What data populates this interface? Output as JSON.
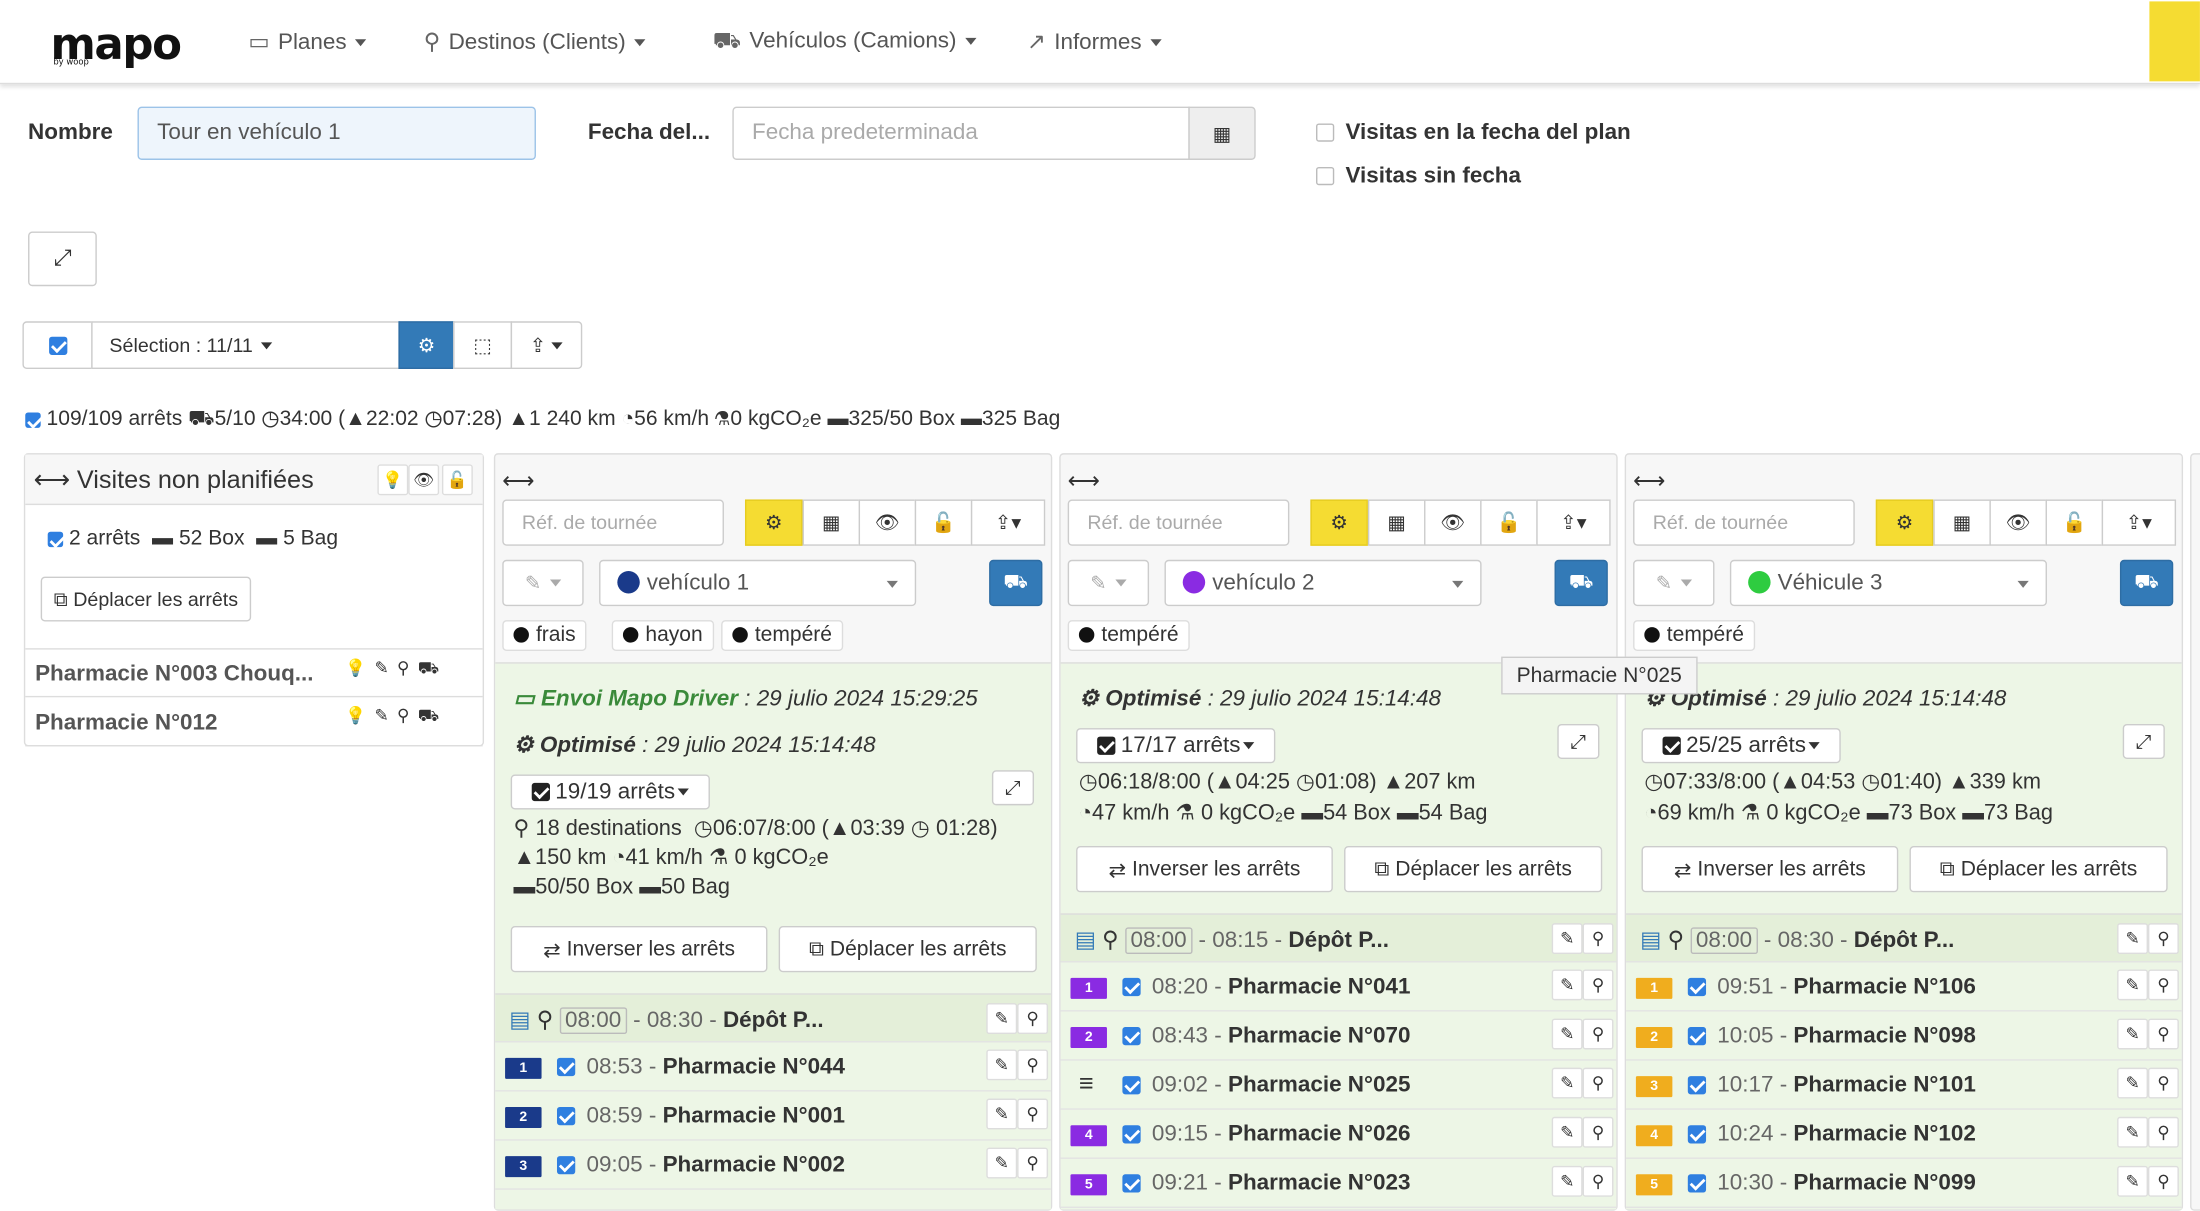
{
  "nav": {
    "logo": "mapo",
    "logo_sub": "by woop",
    "items": [
      "Planes",
      "Destinos (Clients)",
      "Vehículos (Camions)",
      "Informes"
    ]
  },
  "form": {
    "name_label": "Nombre",
    "name_value": "Tour en vehículo 1",
    "date_label": "Fecha del...",
    "date_placeholder": "Fecha predeterminada",
    "chk1": "Visitas en la fecha del plan",
    "chk2": "Visitas sin fecha"
  },
  "selection": {
    "label": "Sélection : 11/11"
  },
  "summary": {
    "stops": "109/109 arrêts",
    "vehicles": "5/10",
    "time": "34:00",
    "drive": "22:02",
    "wait": "07:28)",
    "km": "1 240 km",
    "speed": "56 km/h",
    "co2": "0 kgCO₂e",
    "box": "325/50 Box",
    "bag": "325 Bag"
  },
  "unplanned": {
    "title": "Visites non planifiées",
    "stops": "2 arrêts",
    "box": "52 Box",
    "bag": "5 Bag",
    "move": "Déplacer les arrêts",
    "items": [
      "Pharmacie N°003 Chouq...",
      "Pharmacie N°012"
    ]
  },
  "common": {
    "ref_placeholder": "Réf. de tournée",
    "invert": "Inverser les arrêts",
    "move": "Déplacer les arrêts",
    "optimised": "Optimisé",
    "opt_date": ": 29 julio 2024 15:14:48",
    "tooltip": "Pharmacie N°025"
  },
  "v1": {
    "name": "vehículo 1",
    "color": "#1a3a8a",
    "tags": [
      "frais",
      "hayon",
      "tempéré"
    ],
    "sent": "Envoi Mapo Driver",
    "sent_date": ": 29 julio 2024 15:29:25",
    "stops_btn": "19/19 arrêts",
    "line1": "18 destinations",
    "line1b": "06:07/8:00 (",
    "line1c": "03:39",
    "line2": "01:28)",
    "line2b": "150 km",
    "line2c": "41 km/h",
    "line2d": "0 kgCO₂e",
    "line3": "50/50 Box",
    "line3b": "50 Bag",
    "depot_start": "08:00",
    "depot_end": "- 08:30 -",
    "depot": "Dépôt P...",
    "stops": [
      {
        "n": "1",
        "time": "08:53",
        "name": "Pharmacie N°044"
      },
      {
        "n": "2",
        "time": "08:59",
        "name": "Pharmacie N°001"
      },
      {
        "n": "3",
        "time": "09:05",
        "name": "Pharmacie N°002"
      }
    ]
  },
  "v2": {
    "name": "vehículo 2",
    "color": "#8a2be2",
    "tags": [
      "tempéré"
    ],
    "stops_btn": "17/17 arrêts",
    "l1": "06:18/8:00 (",
    "l1b": "04:25",
    "l1c": "01:08)",
    "l1d": "207 km",
    "l2": "47 km/h",
    "l2b": "0 kgCO₂e",
    "l2c": "54 Box",
    "l2d": "54 Bag",
    "depot_start": "08:00",
    "depot_end": "- 08:15 -",
    "depot": "Dépôt P...",
    "stops": [
      {
        "n": "1",
        "time": "08:20",
        "name": "Pharmacie N°041"
      },
      {
        "n": "2",
        "time": "08:43",
        "name": "Pharmacie N°070"
      },
      {
        "n": "",
        "time": "09:02",
        "name": "Pharmacie N°025"
      },
      {
        "n": "4",
        "time": "09:15",
        "name": "Pharmacie N°026"
      },
      {
        "n": "5",
        "time": "09:21",
        "name": "Pharmacie N°023"
      }
    ]
  },
  "v3": {
    "name": "Véhicule 3",
    "color": "#2ecc40",
    "tags": [
      "tempéré"
    ],
    "stops_btn": "25/25 arrêts",
    "l1": "07:33/8:00 (",
    "l1b": "04:53",
    "l1c": "01:40)",
    "l1d": "339 km",
    "l2": "69 km/h",
    "l2b": "0 kgCO₂e",
    "l2c": "73 Box",
    "l2d": "73 Bag",
    "depot_start": "08:00",
    "depot_end": "- 08:30 -",
    "depot": "Dépôt P...",
    "stops": [
      {
        "n": "1",
        "time": "09:51",
        "name": "Pharmacie N°106"
      },
      {
        "n": "2",
        "time": "10:05",
        "name": "Pharmacie N°098"
      },
      {
        "n": "3",
        "time": "10:17",
        "name": "Pharmacie N°101"
      },
      {
        "n": "4",
        "time": "10:24",
        "name": "Pharmacie N°102"
      },
      {
        "n": "5",
        "time": "10:30",
        "name": "Pharmacie N°099"
      }
    ]
  },
  "colors": {
    "accent": "#337ab7",
    "yellow": "#f5dc32",
    "v1_badge": "#1a3a8a",
    "v2_badge": "#8a2be2",
    "v3_badge": "#f0ad1e"
  }
}
